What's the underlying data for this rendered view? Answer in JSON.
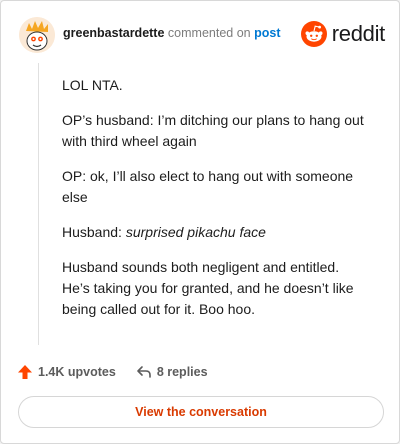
{
  "header": {
    "username": "greenbastardette",
    "action_text": "commented on",
    "post_link": "post",
    "brand_name": "reddit",
    "brand_color": "#ff4500"
  },
  "comment": {
    "paragraphs": [
      "LOL NTA.",
      "OP’s husband: I’m ditching our plans to hang out with third wheel again",
      "OP: ok, I’ll also elect to hang out with someone else",
      "Husband sounds both negligent and entitled. He’s taking you for granted, and he doesn’t like being called out for it. Boo hoo."
    ],
    "husband_label": "Husband:",
    "husband_italic": "surprised pikachu face"
  },
  "actions": {
    "upvotes": "1.4K upvotes",
    "replies": "8 replies",
    "upvote_color": "#ff4500"
  },
  "cta": {
    "label": "View the conversation"
  },
  "icons": [
    "avatar-icon",
    "reddit-logo-icon",
    "upvote-arrow-icon",
    "reply-arrow-icon"
  ]
}
